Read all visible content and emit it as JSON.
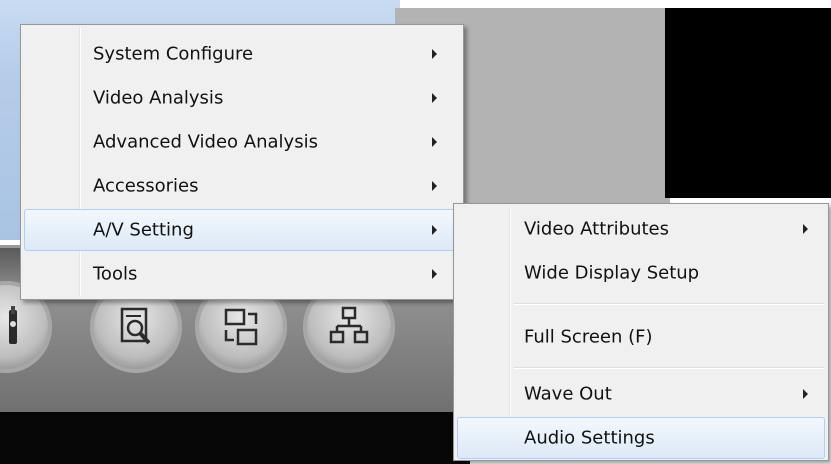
{
  "main_menu": {
    "items": [
      {
        "label": "System Configure",
        "has_submenu": true
      },
      {
        "label": "Video Analysis",
        "has_submenu": true
      },
      {
        "label": "Advanced Video Analysis",
        "has_submenu": true
      },
      {
        "label": "Accessories",
        "has_submenu": true
      },
      {
        "label": "A/V Setting",
        "has_submenu": true,
        "highlighted": true
      },
      {
        "label": "Tools",
        "has_submenu": true
      }
    ]
  },
  "av_submenu": {
    "items": [
      {
        "label": "Video Attributes",
        "has_submenu": true
      },
      {
        "label": "Wide Display Setup",
        "has_submenu": false
      },
      {
        "label": "Full Screen (F)",
        "has_submenu": false
      },
      {
        "label": "Wave Out",
        "has_submenu": true
      },
      {
        "label": "Audio Settings",
        "has_submenu": false,
        "highlighted": true
      }
    ]
  },
  "toolbar": {
    "buttons": [
      {
        "icon": "tool-wrench-icon"
      },
      {
        "icon": "document-search-icon"
      },
      {
        "icon": "sync-transfer-icon"
      },
      {
        "icon": "network-icon"
      }
    ]
  },
  "colors": {
    "menu_bg": "#f0f0f0",
    "highlight_bg": "#dde9f7",
    "highlight_border": "#aecff7"
  }
}
